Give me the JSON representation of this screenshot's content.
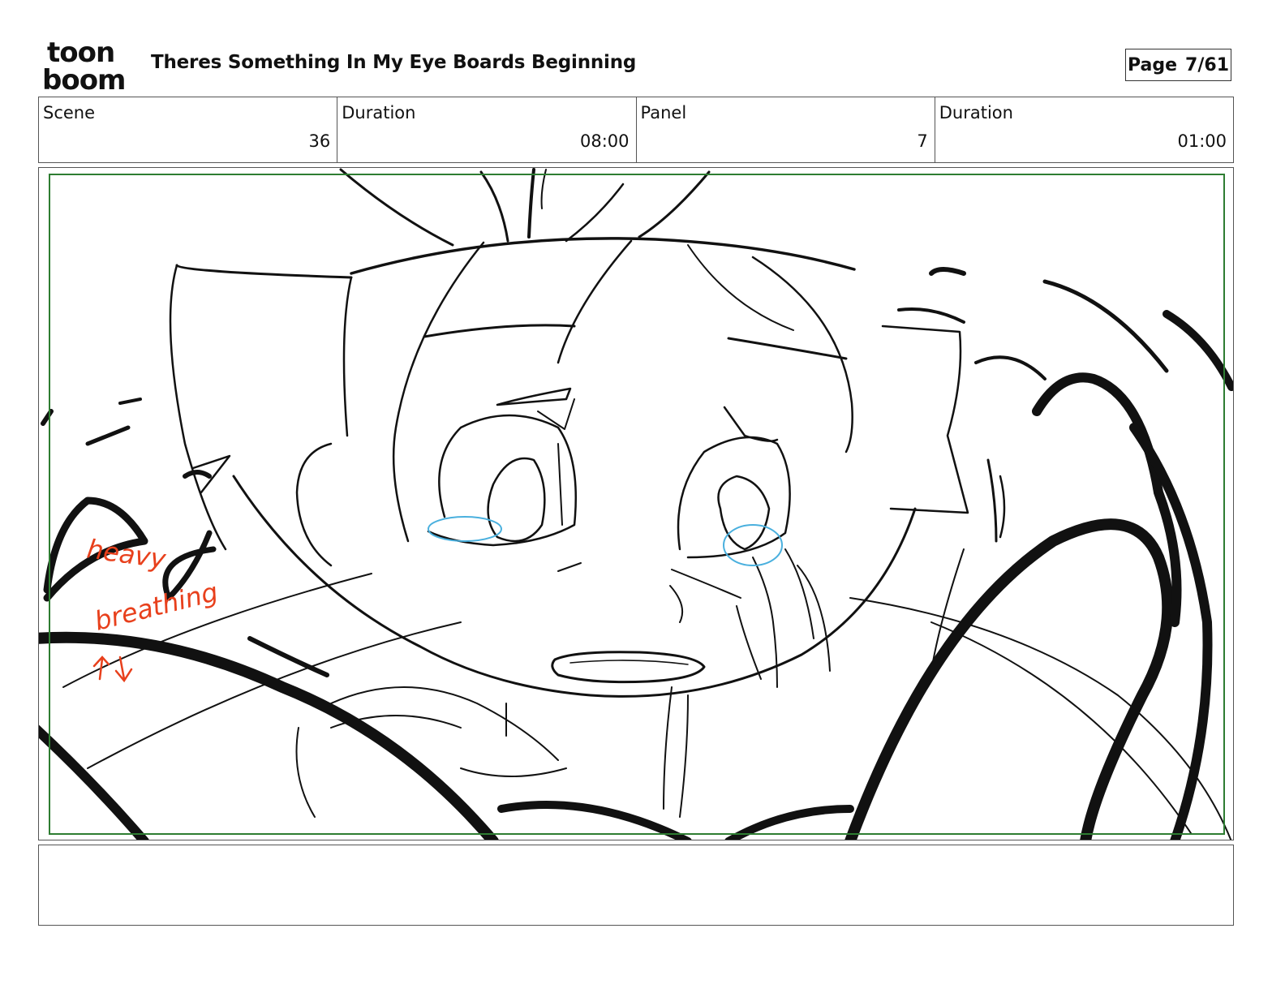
{
  "brand": {
    "logo_line1": "toon",
    "logo_line2": "boom"
  },
  "header": {
    "title": "Theres Something In My Eye Boards Beginning",
    "page_label": "Page",
    "page_value": "7/61"
  },
  "info": {
    "scene_label": "Scene",
    "scene_value": "36",
    "scene_duration_label": "Duration",
    "scene_duration_value": "08:00",
    "panel_label": "Panel",
    "panel_value": "7",
    "panel_duration_label": "Duration",
    "panel_duration_value": "01:00"
  },
  "panel": {
    "annotation_line1": "heavy",
    "annotation_line2": "breathing",
    "annotation_color": "#e8401c",
    "tear_color": "#4ab0de",
    "safe_area_color": "#2e7d32"
  },
  "notes": {
    "text": ""
  }
}
